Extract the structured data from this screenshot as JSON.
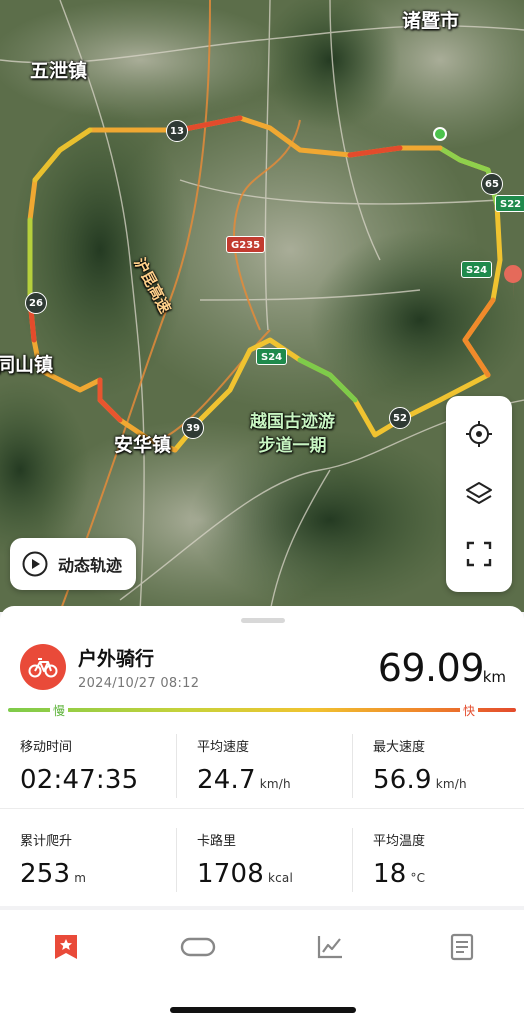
{
  "map": {
    "labels": {
      "zhuji": "诸暨市",
      "wuxie": "五泄镇",
      "tongshan": "同山镇",
      "anhua": "安华镇",
      "scenic_line1": "越国古迹游",
      "scenic_line2": "步道一期",
      "expressway": "沪昆高速"
    },
    "road_shields": [
      "13",
      "26",
      "39",
      "52",
      "65"
    ],
    "highway_shields": [
      "G235",
      "S24",
      "S24",
      "S22"
    ],
    "replay_button_label": "动态轨迹",
    "controls": [
      "locate-icon",
      "layers-icon",
      "fullscreen-icon"
    ],
    "route_colors": {
      "slow": "#7ecb4a",
      "medium": "#f0c330",
      "fast": "#e34b2c"
    }
  },
  "activity": {
    "type": "户外骑行",
    "datetime": "2024/10/27 08:12",
    "distance": "69.09",
    "distance_unit": "km",
    "accent_color": "#e94a39"
  },
  "speed_scale": {
    "slow_label": "慢",
    "fast_label": "快"
  },
  "stats": {
    "moving_time": {
      "label": "移动时间",
      "value": "02:47:35",
      "unit": ""
    },
    "avg_speed": {
      "label": "平均速度",
      "value": "24.7",
      "unit": "km/h"
    },
    "max_speed": {
      "label": "最大速度",
      "value": "56.9",
      "unit": "km/h"
    },
    "elevation_gain": {
      "label": "累计爬升",
      "value": "253",
      "unit": "m"
    },
    "calories": {
      "label": "卡路里",
      "value": "1708",
      "unit": "kcal"
    },
    "avg_temp": {
      "label": "平均温度",
      "value": "18",
      "unit": "°C"
    }
  },
  "tabs": [
    {
      "icon": "bookmark-star-icon",
      "active": true
    },
    {
      "icon": "track-loop-icon",
      "active": false
    },
    {
      "icon": "line-chart-icon",
      "active": false
    },
    {
      "icon": "document-icon",
      "active": false
    }
  ]
}
